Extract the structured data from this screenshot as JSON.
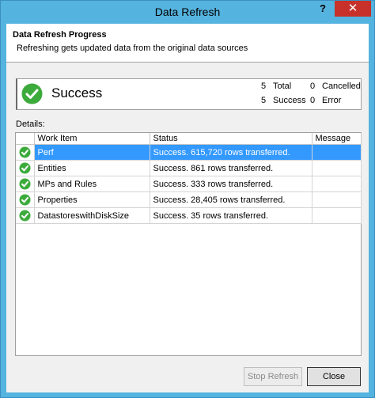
{
  "window": {
    "title": "Data Refresh",
    "help_label": "?",
    "close_label": "✕"
  },
  "header": {
    "title": "Data Refresh Progress",
    "subtitle": "Refreshing gets updated data from the original data sources"
  },
  "summary": {
    "status": "Success",
    "total_count": "5",
    "total_label": "Total",
    "cancelled_count": "0",
    "cancelled_label": "Cancelled",
    "success_count": "5",
    "success_label": "Success",
    "error_count": "0",
    "error_label": "Error"
  },
  "details": {
    "label": "Details:",
    "columns": [
      "Work Item",
      "Status",
      "Message"
    ],
    "rows": [
      {
        "item": "Perf",
        "status": "Success. 615,720 rows transferred.",
        "message": ""
      },
      {
        "item": "Entities",
        "status": "Success. 861 rows transferred.",
        "message": ""
      },
      {
        "item": "MPs and Rules",
        "status": "Success. 333 rows transferred.",
        "message": ""
      },
      {
        "item": "Properties",
        "status": "Success. 28,405 rows transferred.",
        "message": ""
      },
      {
        "item": "DatastoreswithDiskSize",
        "status": "Success. 35 rows transferred.",
        "message": ""
      }
    ]
  },
  "buttons": {
    "stop_refresh": "Stop Refresh",
    "close": "Close"
  },
  "colors": {
    "titlebar": "#55b3df",
    "selection": "#3399ff",
    "success_green": "#3cab3c",
    "close_red": "#c7312a"
  }
}
